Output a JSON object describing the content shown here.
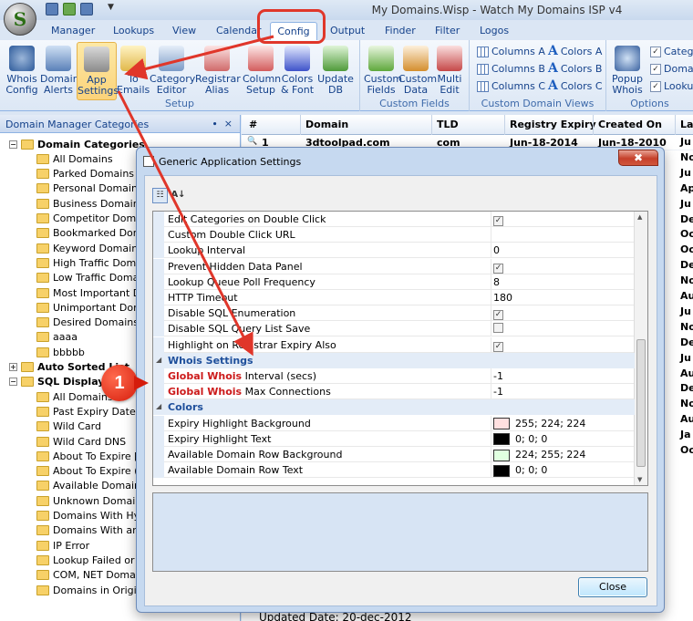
{
  "window": {
    "title": "My Domains.Wisp - Watch My Domains ISP v4"
  },
  "app_orb": {
    "letter": "S"
  },
  "tabs": [
    {
      "label": "Manager"
    },
    {
      "label": "Lookups"
    },
    {
      "label": "View"
    },
    {
      "label": "Calendar"
    },
    {
      "label": "Config"
    },
    {
      "label": "Output"
    },
    {
      "label": "Finder"
    },
    {
      "label": "Filter"
    },
    {
      "label": "Logos"
    }
  ],
  "ribbon": {
    "setup": {
      "label": "Setup",
      "buttons": [
        {
          "line1": "Whois",
          "line2": "Config"
        },
        {
          "line1": "Domain",
          "line2": "Alerts"
        },
        {
          "line1": "App",
          "line2": "Settings"
        },
        {
          "line1": "To",
          "line2": "Emails"
        },
        {
          "line1": "Category",
          "line2": "Editor"
        },
        {
          "line1": "Registrar",
          "line2": "Alias"
        },
        {
          "line1": "Column",
          "line2": "Setup"
        },
        {
          "line1": "Colors",
          "line2": "& Font"
        },
        {
          "line1": "Update",
          "line2": "DB"
        }
      ]
    },
    "custom_fields": {
      "label": "Custom Fields",
      "buttons": [
        {
          "line1": "Custom",
          "line2": "Fields"
        },
        {
          "line1": "Custom",
          "line2": "Data"
        },
        {
          "line1": "Multi",
          "line2": "Edit"
        }
      ]
    },
    "custom_domain_views": {
      "label": "Custom Domain Views",
      "items": [
        "Columns A",
        "Columns B",
        "Columns C",
        "Colors A",
        "Colors B",
        "Colors C"
      ]
    },
    "options": {
      "label": "Options",
      "popup": {
        "line1": "Popup",
        "line2": "Whois"
      },
      "checks": [
        "Catego",
        "Domai",
        "Looku"
      ]
    }
  },
  "left_pane": {
    "header": "Domain Manager Categories",
    "pin": "∙",
    "close": "×",
    "tree": [
      {
        "label": "Domain Categories",
        "level": 0,
        "bold": true,
        "expander": "−"
      },
      {
        "label": "All Domains",
        "level": 1
      },
      {
        "label": "Parked Domains",
        "level": 1
      },
      {
        "label": "Personal Domains",
        "level": 1
      },
      {
        "label": "Business Domains",
        "level": 1
      },
      {
        "label": "Competitor Domai",
        "level": 1
      },
      {
        "label": "Bookmarked Doma",
        "level": 1
      },
      {
        "label": "Keyword Domains",
        "level": 1
      },
      {
        "label": "High Traffic Doma",
        "level": 1
      },
      {
        "label": "Low Traffic Domai",
        "level": 1
      },
      {
        "label": "Most Important Do",
        "level": 1
      },
      {
        "label": "Unimportant Doma",
        "level": 1
      },
      {
        "label": "Desired Domains",
        "level": 1
      },
      {
        "label": "aaaa",
        "level": 1
      },
      {
        "label": "bbbbb",
        "level": 1
      },
      {
        "label": "Auto Sorted List",
        "level": 0,
        "bold": true,
        "expander": "+"
      },
      {
        "label": "SQL Display Q",
        "level": 0,
        "bold": true,
        "expander": "−"
      },
      {
        "label": "All Domains",
        "level": 1
      },
      {
        "label": "Past Expiry Date",
        "level": 1
      },
      {
        "label": "Wild Card",
        "level": 1
      },
      {
        "label": "Wild Card DNS",
        "level": 1
      },
      {
        "label": "About To Expire [R",
        "level": 1
      },
      {
        "label": "About To Expire (R",
        "level": 1
      },
      {
        "label": "Available Domains",
        "level": 1
      },
      {
        "label": "Unknown Domains",
        "level": 1
      },
      {
        "label": "Domains With Hyp",
        "level": 1
      },
      {
        "label": "Domains With an I",
        "level": 1
      },
      {
        "label": "IP Error",
        "level": 1
      },
      {
        "label": "Lookup Failed or N",
        "level": 1
      },
      {
        "label": "COM, NET Domain",
        "level": 1
      },
      {
        "label": "Domains in Origina",
        "level": 1
      }
    ]
  },
  "grid": {
    "columns": [
      "#",
      "Domain",
      "TLD",
      "Registry Expiry",
      "Created On",
      "La"
    ],
    "first_row": {
      "num": "1",
      "domain": "3dtoolpad.com",
      "tld": "com",
      "expiry": "Jun-18-2014",
      "created": "Jun-18-2010"
    },
    "last_col_values": [
      "Ju",
      "No",
      "Ju",
      "Ap",
      "Ju",
      "De",
      "Oc",
      "Oc",
      "De",
      "No",
      "Au",
      "Ju",
      "No",
      "De",
      "Ju",
      "Au",
      "De",
      "No",
      "Au",
      "Ja",
      "Oc"
    ]
  },
  "dialog": {
    "title": "Generic Application Settings",
    "close_x": "✖",
    "toolbar": {
      "categorized": "☷",
      "alpha": "A↓"
    },
    "rows": [
      {
        "type": "row",
        "name": "Edit Categories on Double Click",
        "value_check": "✓"
      },
      {
        "type": "row",
        "name": "Custom Double Click URL",
        "value": ""
      },
      {
        "type": "row",
        "name": "Lookup Interval",
        "value": "0"
      },
      {
        "type": "row",
        "name": "Prevent Hidden Data Panel",
        "value_check": "✓"
      },
      {
        "type": "row",
        "name": "Lookup Queue Poll Frequency",
        "value": "8"
      },
      {
        "type": "row",
        "name": "HTTP Timeout",
        "value": "180"
      },
      {
        "type": "row",
        "name": "Disable SQL Enumeration",
        "value_check": "✓"
      },
      {
        "type": "row",
        "name": "Disable SQL Query List Save",
        "value_check": ""
      },
      {
        "type": "row",
        "name": "Highlight on Registrar Expiry Also",
        "value_check": "✓"
      },
      {
        "type": "cat",
        "name": "Whois Settings"
      },
      {
        "type": "row",
        "name_red": "Global Whois",
        "name_rest": " Interval (secs)",
        "value": "-1"
      },
      {
        "type": "row",
        "name_red": "Global Whois",
        "name_rest": " Max Connections",
        "value": "-1"
      },
      {
        "type": "cat",
        "name": "Colors"
      },
      {
        "type": "row",
        "name": "Expiry Highlight Background",
        "color": "#ffe0e0",
        "value": "255; 224; 224"
      },
      {
        "type": "row",
        "name": "Expiry Highlight Text",
        "color": "#000000",
        "value": "0; 0; 0"
      },
      {
        "type": "row",
        "name": "Available Domain Row Background",
        "color": "#e0ffe0",
        "value": "224; 255; 224"
      },
      {
        "type": "row",
        "name": "Available Domain Row Text",
        "color": "#000000",
        "value": "0; 0; 0"
      }
    ],
    "close_button": "Close"
  },
  "annotation": {
    "badge": "1",
    "accent": "#e0362a"
  },
  "footer": {
    "text": "Updated Date: 20-dec-2012"
  }
}
